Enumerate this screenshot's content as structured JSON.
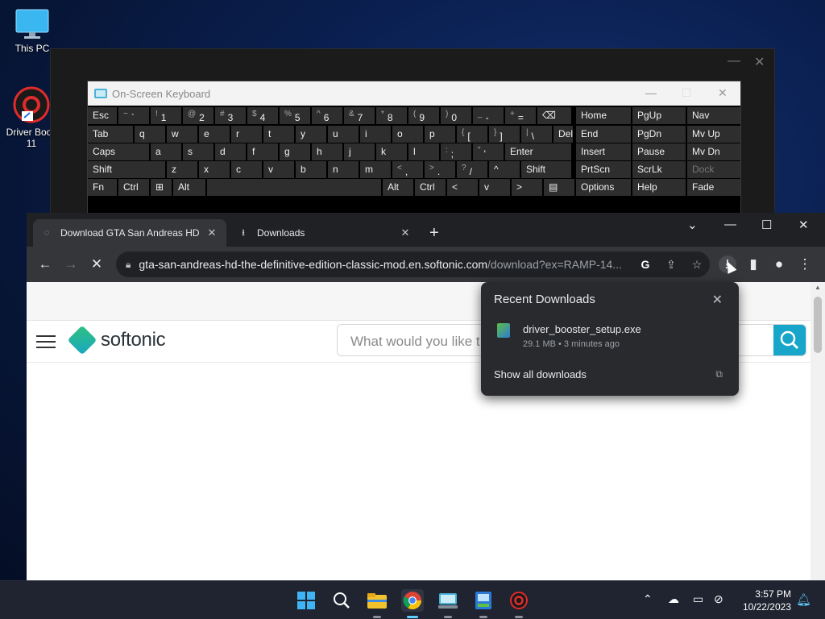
{
  "desktop": {
    "icons": [
      {
        "label": "This PC",
        "icon": "monitor-icon"
      },
      {
        "label": "Driver Boos\n11",
        "icon": "driver-booster-icon"
      }
    ]
  },
  "osk": {
    "title": "On-Screen Keyboard",
    "rows": [
      [
        {
          "l": "Esc"
        },
        {
          "s": "~",
          "m": "`"
        },
        {
          "s": "!",
          "m": "1"
        },
        {
          "s": "@",
          "m": "2"
        },
        {
          "s": "#",
          "m": "3"
        },
        {
          "s": "$",
          "m": "4"
        },
        {
          "s": "%",
          "m": "5"
        },
        {
          "s": "^",
          "m": "6"
        },
        {
          "s": "&",
          "m": "7"
        },
        {
          "s": "*",
          "m": "8"
        },
        {
          "s": "(",
          "m": "9"
        },
        {
          "s": ")",
          "m": "0"
        },
        {
          "s": "_",
          "m": "-"
        },
        {
          "s": "+",
          "m": "="
        },
        {
          "l": "⌫"
        },
        {
          "l": "Home"
        },
        {
          "l": "PgUp"
        },
        {
          "l": "Nav"
        }
      ],
      [
        {
          "l": "Tab"
        },
        {
          "l": "q"
        },
        {
          "l": "w"
        },
        {
          "l": "e"
        },
        {
          "l": "r"
        },
        {
          "l": "t"
        },
        {
          "l": "y"
        },
        {
          "l": "u"
        },
        {
          "l": "i"
        },
        {
          "l": "o"
        },
        {
          "l": "p"
        },
        {
          "s": "{",
          "m": "["
        },
        {
          "s": "}",
          "m": "]"
        },
        {
          "s": "|",
          "m": "\\"
        },
        {
          "l": "Del"
        },
        {
          "l": "End"
        },
        {
          "l": "PgDn"
        },
        {
          "l": "Mv Up"
        }
      ],
      [
        {
          "l": "Caps"
        },
        {
          "l": "a"
        },
        {
          "l": "s"
        },
        {
          "l": "d"
        },
        {
          "l": "f"
        },
        {
          "l": "g"
        },
        {
          "l": "h"
        },
        {
          "l": "j"
        },
        {
          "l": "k"
        },
        {
          "l": "l"
        },
        {
          "s": ":",
          "m": ";"
        },
        {
          "s": "\"",
          "m": "'"
        },
        {
          "l": "Enter"
        },
        {
          "l": "Insert"
        },
        {
          "l": "Pause"
        },
        {
          "l": "Mv Dn"
        }
      ],
      [
        {
          "l": "Shift"
        },
        {
          "l": "z"
        },
        {
          "l": "x"
        },
        {
          "l": "c"
        },
        {
          "l": "v"
        },
        {
          "l": "b"
        },
        {
          "l": "n"
        },
        {
          "l": "m"
        },
        {
          "s": "<",
          "m": ","
        },
        {
          "s": ">",
          "m": "."
        },
        {
          "s": "?",
          "m": "/"
        },
        {
          "l": "^"
        },
        {
          "l": "Shift"
        },
        {
          "l": "PrtScn"
        },
        {
          "l": "ScrLk"
        },
        {
          "l": "Dock"
        }
      ],
      [
        {
          "l": "Fn"
        },
        {
          "l": "Ctrl"
        },
        {
          "l": "⊞"
        },
        {
          "l": "Alt"
        },
        {
          "l": ""
        },
        {
          "l": "Alt"
        },
        {
          "l": "Ctrl"
        },
        {
          "l": "<"
        },
        {
          "l": "v"
        },
        {
          "l": ">"
        },
        {
          "l": "▤"
        },
        {
          "l": "Options"
        },
        {
          "l": "Help"
        },
        {
          "l": "Fade"
        }
      ]
    ]
  },
  "chrome": {
    "tabs": [
      {
        "title": "Download GTA San Andreas HD",
        "close": "✕"
      },
      {
        "title": "Downloads",
        "close": "✕"
      }
    ],
    "new_tab": "+",
    "url_host": "gta-san-andreas-hd-the-definitive-edition-classic-mod.en.softonic.com",
    "url_path": "/download?ex=RAMP-14...",
    "page": {
      "logo_text": "softonic",
      "search_placeholder": "What would you like t"
    },
    "downloads_popup": {
      "title": "Recent Downloads",
      "file_name": "driver_booster_setup.exe",
      "file_meta": "29.1 MB • 3 minutes ago",
      "show_all": "Show all downloads"
    }
  },
  "taskbar": {
    "apps": [
      "windows-start-icon",
      "search-icon",
      "file-explorer-icon",
      "chrome-icon",
      "onscreen-keyboard-icon",
      "installer-icon",
      "driver-booster-icon"
    ],
    "clock_time": "3:57 PM",
    "clock_date": "10/22/2023"
  },
  "colors": {
    "accent": "#17a6c9",
    "taskbar": "#1f2430",
    "chrome_dark": "#35363a"
  }
}
